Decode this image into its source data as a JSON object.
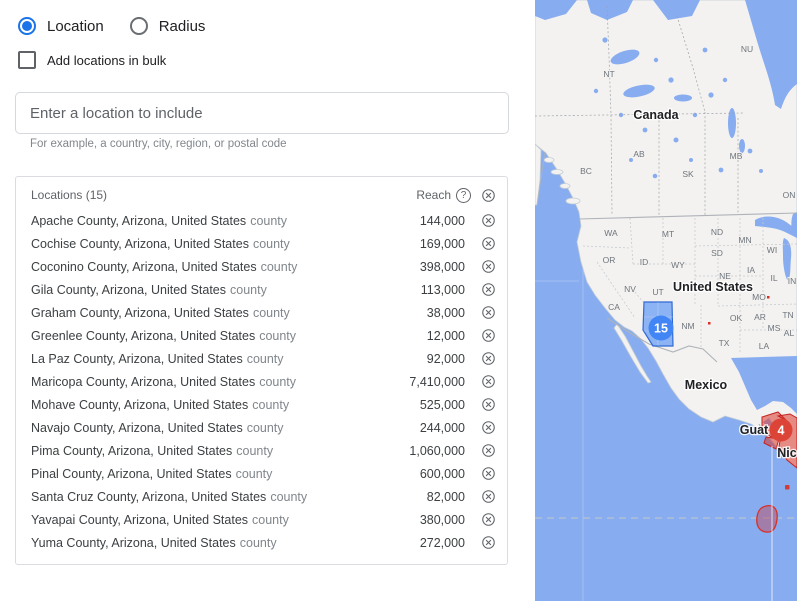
{
  "ui": {
    "mode": {
      "options": [
        {
          "label": "Location",
          "selected": true
        },
        {
          "label": "Radius",
          "selected": false
        }
      ]
    },
    "bulk": {
      "label": "Add locations in bulk",
      "checked": false
    },
    "search": {
      "placeholder": "Enter a location to include",
      "helper": "For example, a country, city, region, or postal code"
    },
    "icons": {
      "help_glyph": "?"
    },
    "panel": {
      "title": "Locations (15)",
      "reach_label": "Reach",
      "rows": [
        {
          "name": "Apache County, Arizona, United States",
          "type": "county",
          "reach": "144,000"
        },
        {
          "name": "Cochise County, Arizona, United States",
          "type": "county",
          "reach": "169,000"
        },
        {
          "name": "Coconino County, Arizona, United States",
          "type": "county",
          "reach": "398,000"
        },
        {
          "name": "Gila County, Arizona, United States",
          "type": "county",
          "reach": "113,000"
        },
        {
          "name": "Graham County, Arizona, United States",
          "type": "county",
          "reach": "38,000"
        },
        {
          "name": "Greenlee County, Arizona, United States",
          "type": "county",
          "reach": "12,000"
        },
        {
          "name": "La Paz County, Arizona, United States",
          "type": "county",
          "reach": "92,000"
        },
        {
          "name": "Maricopa County, Arizona, United States",
          "type": "county",
          "reach": "7,410,000"
        },
        {
          "name": "Mohave County, Arizona, United States",
          "type": "county",
          "reach": "525,000"
        },
        {
          "name": "Navajo County, Arizona, United States",
          "type": "county",
          "reach": "244,000"
        },
        {
          "name": "Pima County, Arizona, United States",
          "type": "county",
          "reach": "1,060,000"
        },
        {
          "name": "Pinal County, Arizona, United States",
          "type": "county",
          "reach": "600,000"
        },
        {
          "name": "Santa Cruz County, Arizona, United States",
          "type": "county",
          "reach": "82,000"
        },
        {
          "name": "Yavapai County, Arizona, United States",
          "type": "county",
          "reach": "380,000"
        },
        {
          "name": "Yuma County, Arizona, United States",
          "type": "county",
          "reach": "272,000"
        }
      ]
    }
  },
  "map": {
    "selected_badge": "15",
    "excluded_badge": "4",
    "labels": {
      "canada": "Canada",
      "united_states": "United States",
      "mexico": "Mexico",
      "guatemala": "Guat",
      "nicaragua": "Nic"
    },
    "regions": [
      "NT",
      "NU",
      "BC",
      "AB",
      "SK",
      "MB",
      "ON",
      "WA",
      "MT",
      "ND",
      "MN",
      "WI",
      "OR",
      "ID",
      "WY",
      "SD",
      "NE",
      "IA",
      "IL",
      "IN",
      "NV",
      "UT",
      "CA",
      "MO",
      "OK",
      "AR",
      "TN",
      "NM",
      "TX",
      "MS",
      "AL",
      "LA"
    ],
    "colors": {
      "water": "#87acf0",
      "land": "#f3f2f0",
      "selected_region": "#4285f4",
      "excluded_region": "#d93025"
    }
  }
}
